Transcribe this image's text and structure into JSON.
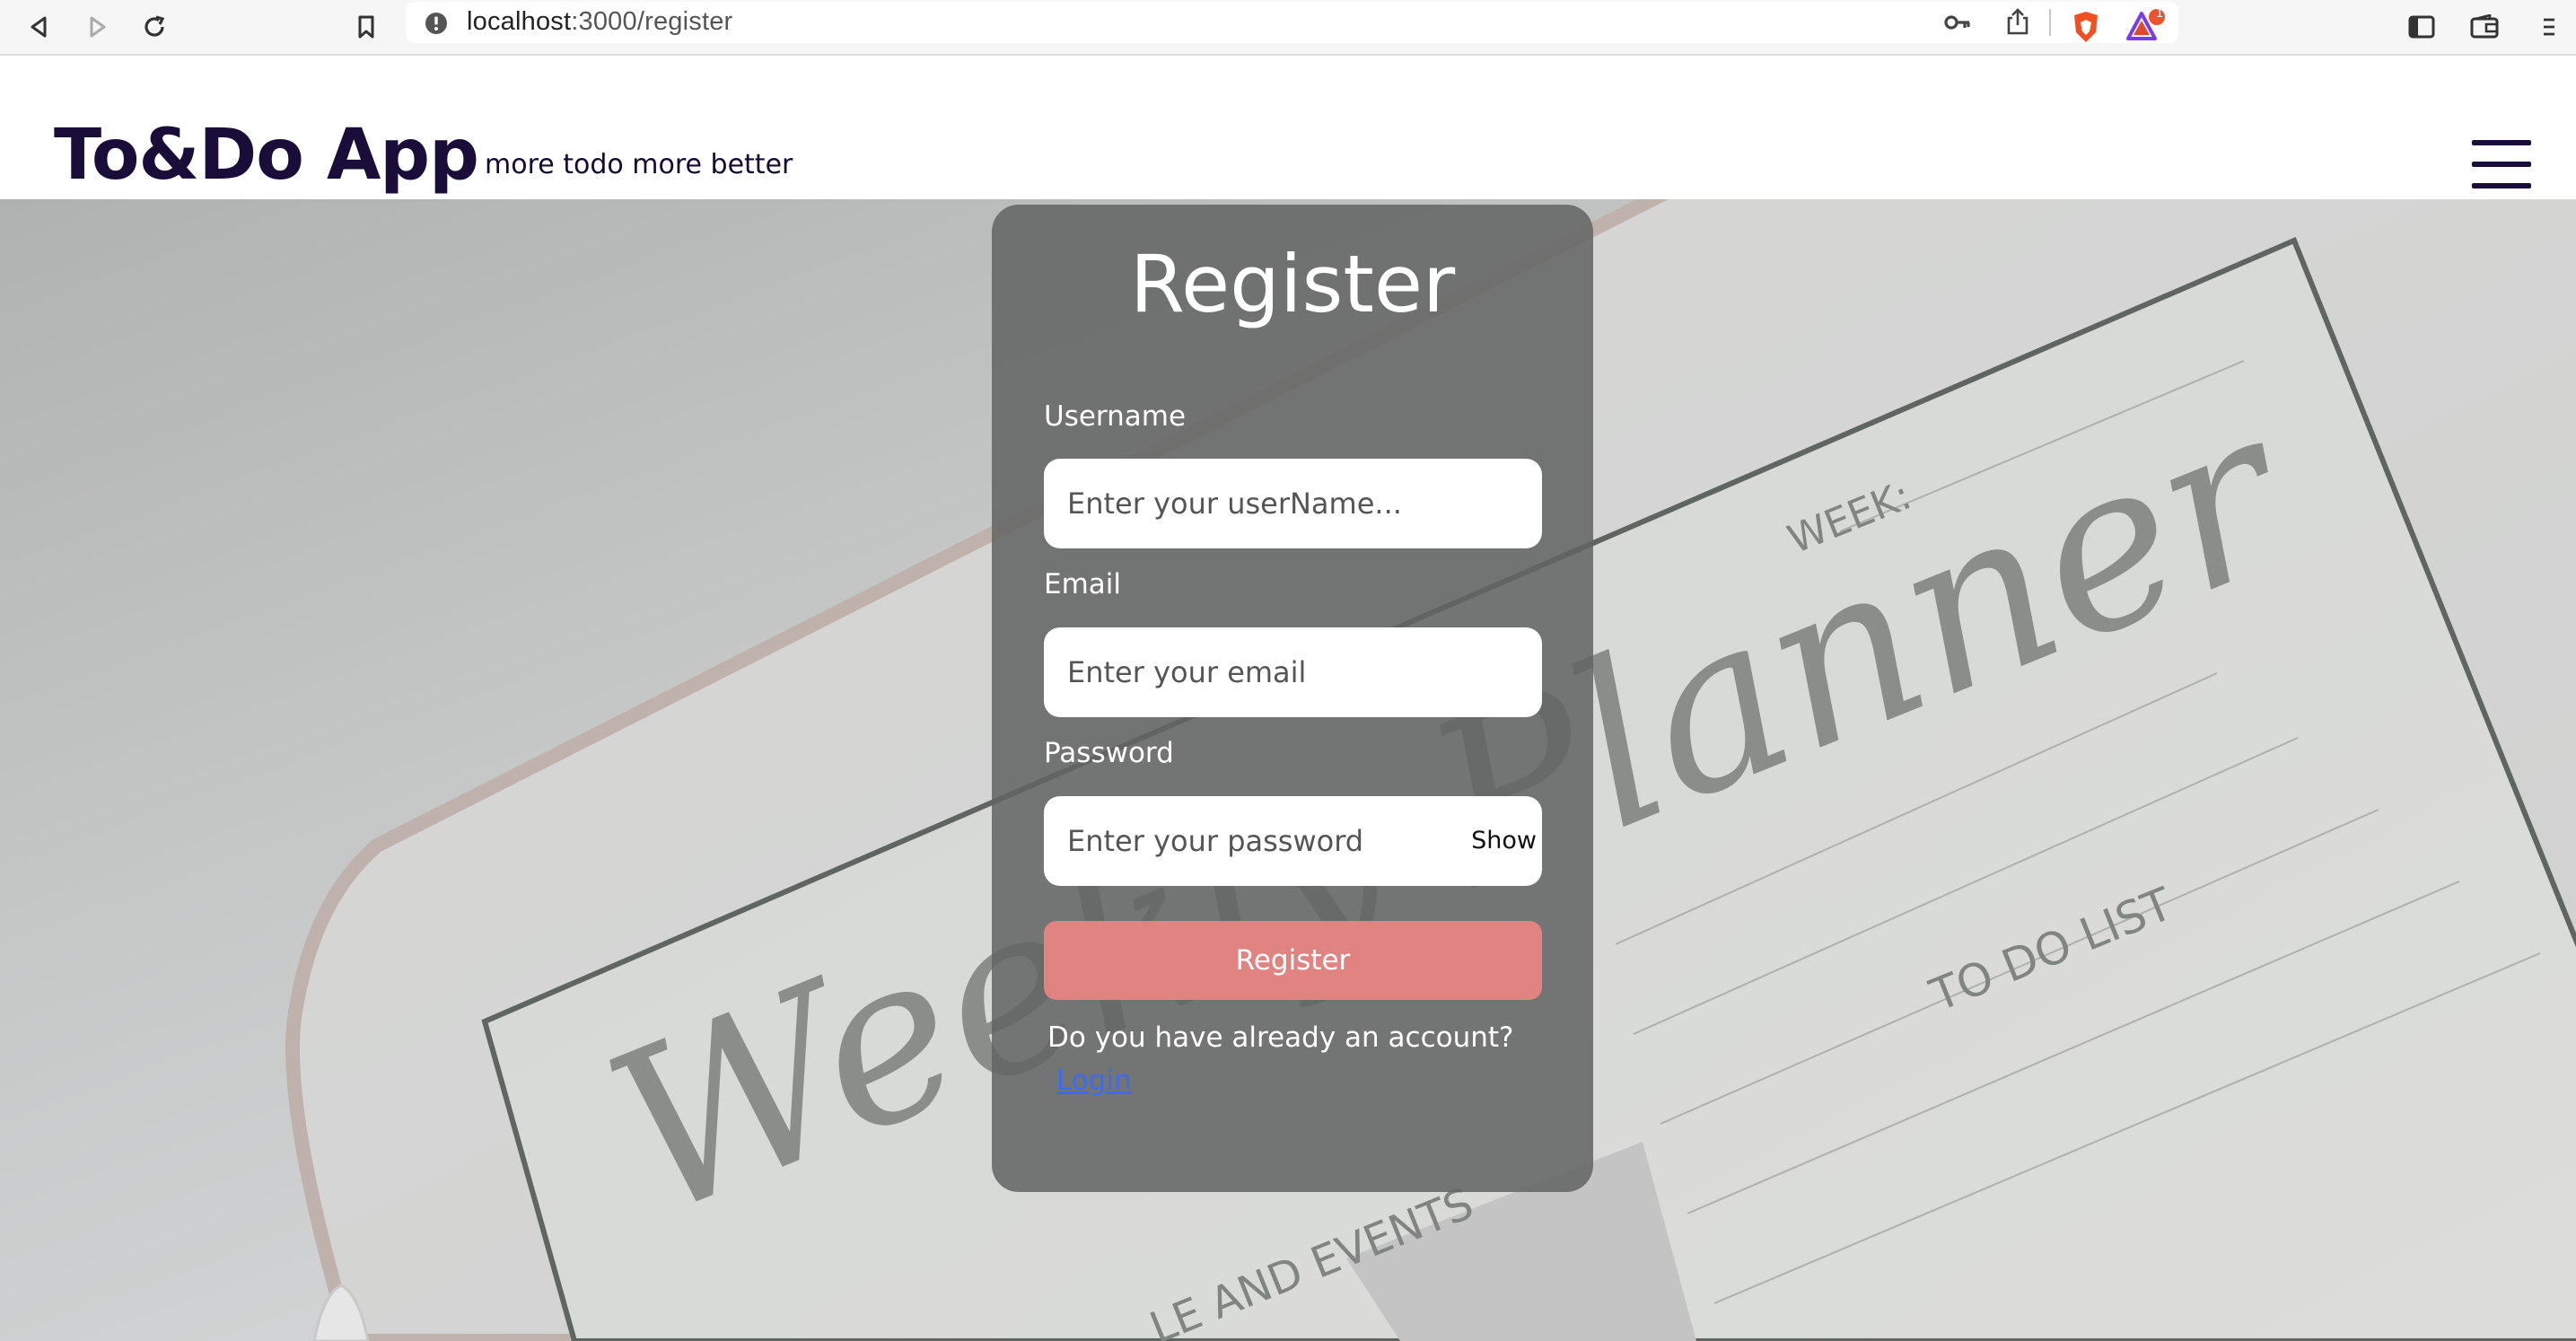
{
  "browser": {
    "url_host": "localhost",
    "url_path": ":3000/register",
    "brave_badge_count": "1"
  },
  "header": {
    "brand": "To&Do App",
    "tagline": "more todo more better"
  },
  "hero_text": {
    "script_title": "Weekly Planner",
    "week_label": "WEEK:",
    "todo_label": "TO DO LIST",
    "events_label": "LE AND EVENTS"
  },
  "register": {
    "title": "Register",
    "username_label": "Username",
    "username_placeholder": "Enter your userName...",
    "email_label": "Email",
    "email_placeholder": "Enter your email",
    "password_label": "Password",
    "password_placeholder": "Enter your password",
    "show_label": "Show",
    "submit_label": "Register",
    "account_prompt": "Do you have already an account?",
    "login_link": "Login"
  },
  "colors": {
    "brand": "#1a0d3a",
    "card_bg": "#626463",
    "submit_bg": "#e08381",
    "link": "#3b6cf0"
  }
}
